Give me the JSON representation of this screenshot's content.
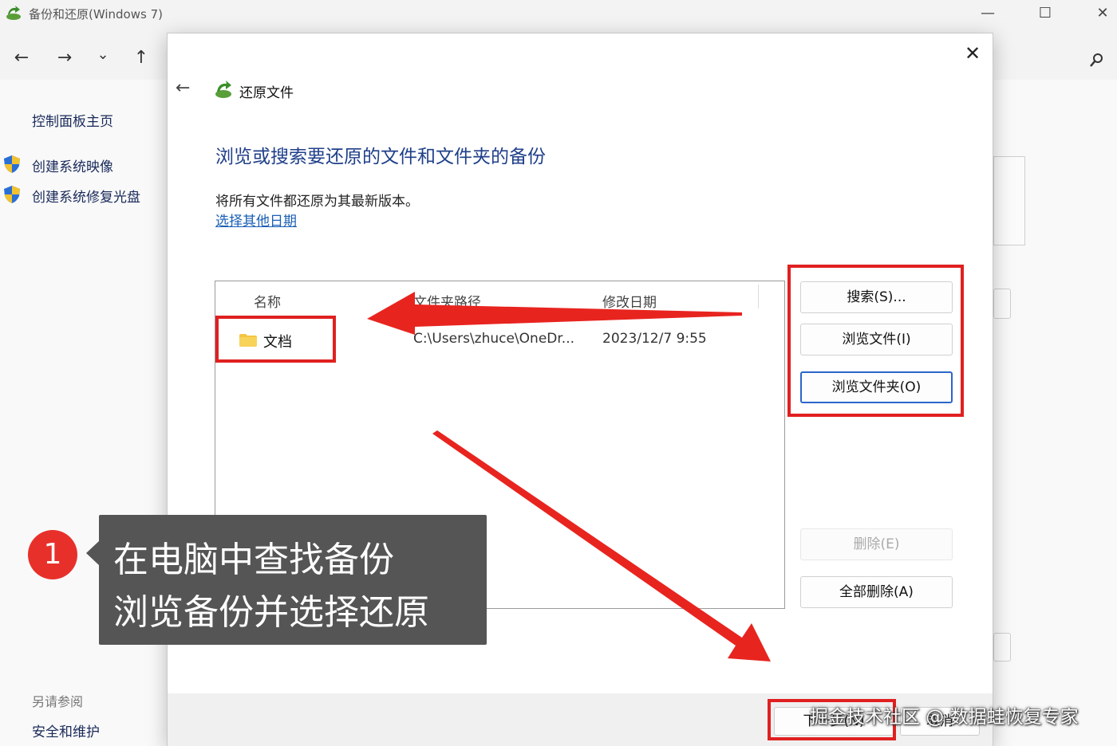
{
  "window": {
    "title": "备份和还原(Windows 7)",
    "minimize_icon": "minimize-icon",
    "maximize_icon": "maximize-icon",
    "close_icon": "close-icon"
  },
  "nav": {
    "back": "←",
    "forward": "→",
    "recent": "⌄",
    "up": "↑"
  },
  "sidebar": {
    "home": "控制面板主页",
    "items": [
      {
        "label": "创建系统映像",
        "icon": "shield-icon"
      },
      {
        "label": "创建系统修复光盘",
        "icon": "shield-icon"
      }
    ],
    "see_also_heading": "另请参阅",
    "see_also_items": [
      "安全和维护"
    ]
  },
  "dialog": {
    "title": "还原文件",
    "heading": "浏览或搜索要还原的文件和文件夹的备份",
    "description": "将所有文件都还原为其最新版本。",
    "choose_date_link": "选择其他日期",
    "columns": [
      "名称",
      "文件夹路径",
      "修改日期"
    ],
    "rows": [
      {
        "name": "文档",
        "path": "C:\\Users\\zhuce\\OneDr...",
        "modified": "2023/12/7 9:55"
      }
    ],
    "buttons": {
      "search": "搜索(S)...",
      "browse_files": "浏览文件(I)",
      "browse_folders": "浏览文件夹(O)",
      "remove": "删除(E)",
      "remove_all": "全部删除(A)"
    },
    "footer": {
      "next": "下一步(N)",
      "cancel": "取消"
    }
  },
  "annotation": {
    "step_number": "1",
    "caption_line1": "在电脑中查找备份",
    "caption_line2": "浏览备份并选择还原",
    "highlight_color": "#e02020"
  },
  "watermark": "掘金技术社区 @ 数据蛙恢复专家"
}
